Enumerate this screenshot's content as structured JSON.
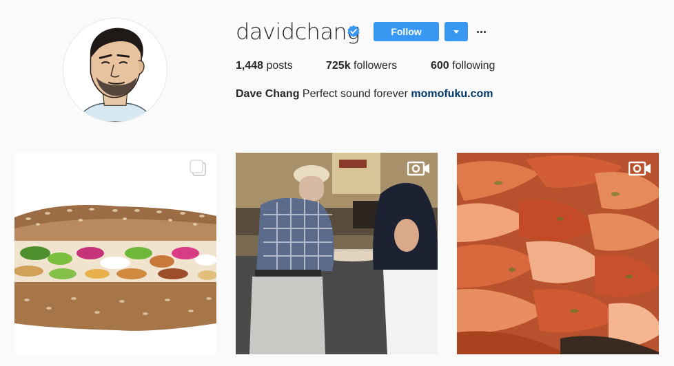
{
  "profile": {
    "username": "davidchang",
    "verified": true,
    "follow_label": "Follow",
    "stats": {
      "posts_count": "1,448",
      "posts_label": "posts",
      "followers_count": "725k",
      "followers_label": "followers",
      "following_count": "600",
      "following_label": "following"
    },
    "bio": {
      "full_name": "Dave Chang",
      "text": "Perfect sound forever",
      "link": "momofuku.com"
    }
  },
  "colors": {
    "accent": "#3897f0",
    "link": "#003569",
    "background": "#fafafa",
    "text": "#262626"
  },
  "icons": {
    "verified": "verified-badge-icon",
    "dropdown": "chevron-down-icon",
    "more": "more-options-icon",
    "multiple": "carousel-icon",
    "video": "video-camera-icon"
  },
  "posts": [
    {
      "type": "carousel",
      "subject": "sandwich"
    },
    {
      "type": "video",
      "subject": "pizza-shop"
    },
    {
      "type": "video",
      "subject": "kimchi"
    }
  ]
}
